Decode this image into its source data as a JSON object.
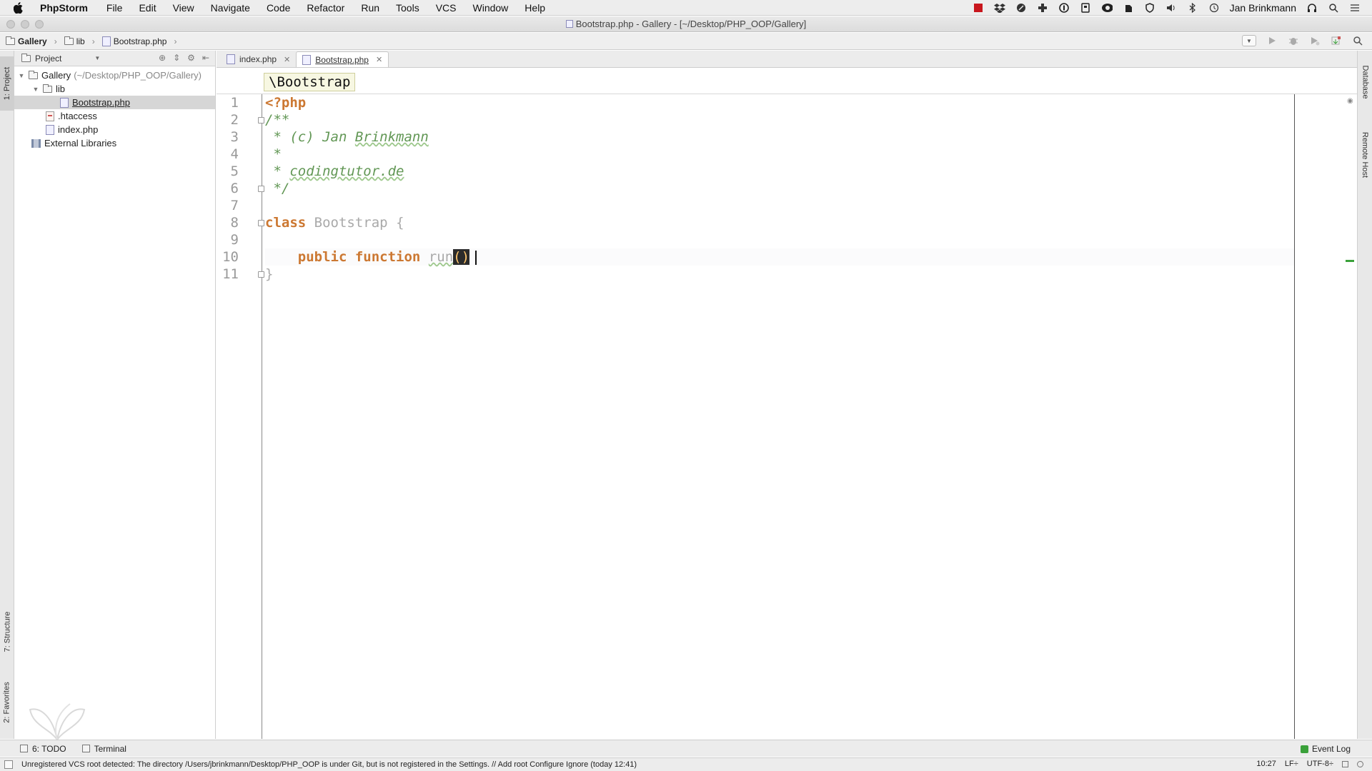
{
  "menubar": {
    "app": "PhpStorm",
    "items": [
      "File",
      "Edit",
      "View",
      "Navigate",
      "Code",
      "Refactor",
      "Run",
      "Tools",
      "VCS",
      "Window",
      "Help"
    ],
    "user": "Jan Brinkmann"
  },
  "window": {
    "title": "Bootstrap.php - Gallery - [~/Desktop/PHP_OOP/Gallery]"
  },
  "navbar": {
    "crumbs": [
      "Gallery",
      "lib",
      "Bootstrap.php"
    ]
  },
  "left_tabs": {
    "project": "1: Project",
    "structure": "7: Structure",
    "favorites": "2: Favorites"
  },
  "project_panel": {
    "selector": "Project",
    "tree": [
      {
        "label": "Gallery",
        "hint": "(~/Desktop/PHP_OOP/Gallery)",
        "type": "folder",
        "depth": 0,
        "expanded": true
      },
      {
        "label": "lib",
        "type": "folder",
        "depth": 1,
        "expanded": true
      },
      {
        "label": "Bootstrap.php",
        "type": "php",
        "depth": 2,
        "selected": true
      },
      {
        "label": ".htaccess",
        "type": "htaccess",
        "depth": 1
      },
      {
        "label": "index.php",
        "type": "php",
        "depth": 1
      },
      {
        "label": "External Libraries",
        "type": "library",
        "depth": 0
      }
    ]
  },
  "editor": {
    "tabs": [
      {
        "label": "index.php",
        "active": false
      },
      {
        "label": "Bootstrap.php",
        "active": true
      }
    ],
    "breadcrumb": "\\Bootstrap",
    "lines": [
      "<?php",
      "/**",
      " * (c) Jan Brinkmann",
      " *",
      " * codingtutor.de",
      " */",
      "",
      "class Bootstrap {",
      "",
      "    public function run() ",
      "}"
    ],
    "line_numbers": [
      "1",
      "2",
      "3",
      "4",
      "5",
      "6",
      "7",
      "8",
      "9",
      "10",
      "11"
    ],
    "tokens": {
      "open_tag": "<?php",
      "doc_open": "/**",
      "doc_star": " * ",
      "doc_author": "(c) Jan Brinkmann",
      "doc_author_pre": "(c) Jan ",
      "doc_author_name": "Brinkmann",
      "doc_blank": " *",
      "doc_site": "codingtutor.de",
      "doc_close": " */",
      "kw_class": "class",
      "class_name": "Bootstrap",
      "brace_open": "{",
      "kw_public": "public",
      "kw_function": "function",
      "fn_name": "run",
      "parens": "()",
      "brace_close": "}"
    }
  },
  "right_tabs": {
    "database": "Database",
    "remote": "Remote Host"
  },
  "bottombar": {
    "todo": "6: TODO",
    "terminal": "Terminal",
    "event_log": "Event Log"
  },
  "statusbar": {
    "message": "Unregistered VCS root detected: The directory /Users/jbrinkmann/Desktop/PHP_OOP is under Git, but is not registered in the Settings. // Add root  Configure  Ignore (today 12:41)",
    "position": "10:27",
    "line_sep": "LF÷",
    "encoding": "UTF-8÷"
  },
  "colors": {
    "keyword": "#cc7832",
    "comment": "#629755",
    "accent_green": "#3aa13a"
  }
}
